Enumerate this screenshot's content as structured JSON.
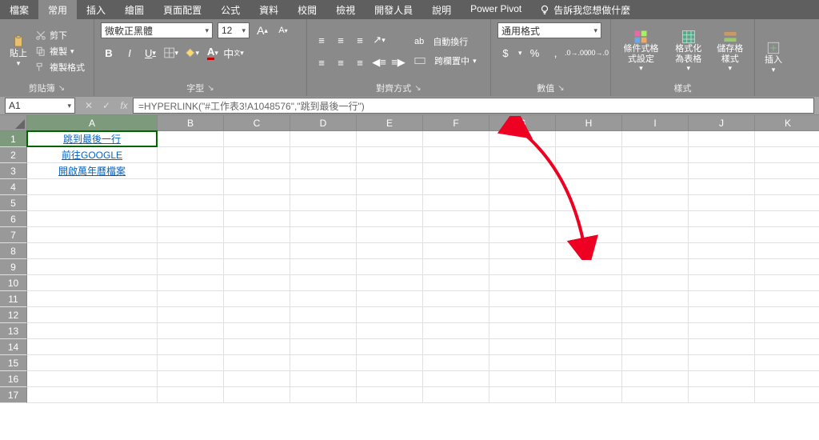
{
  "tabs": [
    "檔案",
    "常用",
    "插入",
    "繪圖",
    "頁面配置",
    "公式",
    "資料",
    "校閱",
    "檢視",
    "開發人員",
    "說明",
    "Power Pivot"
  ],
  "active_tab": "常用",
  "tell_me": "告訴我您想做什麼",
  "clipboard": {
    "paste": "貼上",
    "cut": "剪下",
    "copy": "複製",
    "format_painter": "複製格式",
    "label": "剪貼簿"
  },
  "font": {
    "name": "微軟正黑體",
    "size": "12",
    "label": "字型"
  },
  "align": {
    "wrap": "自動換行",
    "merge": "跨欄置中",
    "label": "對齊方式"
  },
  "number": {
    "format": "通用格式",
    "dollar": "$",
    "percent": "%",
    "comma": ",",
    "inc": ".0",
    "dec": ".00",
    "label": "數值"
  },
  "styles": {
    "cond": "條件式格式設定",
    "table": "格式化為表格",
    "cellstyle": "儲存格樣式",
    "label": "樣式"
  },
  "cells": {
    "insert": "插入"
  },
  "namebox": "A1",
  "fx_label": "fx",
  "formula": "=HYPERLINK(\"#工作表3!A1048576\",\"跳到最後一行\")",
  "columns": [
    "A",
    "B",
    "C",
    "D",
    "E",
    "F",
    "G",
    "H",
    "I",
    "J",
    "K"
  ],
  "rows": [
    "1",
    "2",
    "3",
    "4",
    "5",
    "6",
    "7",
    "8",
    "9",
    "10",
    "11",
    "12",
    "13",
    "14",
    "15",
    "16",
    "17"
  ],
  "cells_data": {
    "A1": "跳到最後一行",
    "A2": "前往GOOGLE",
    "A3": "開啟萬年曆檔案"
  }
}
